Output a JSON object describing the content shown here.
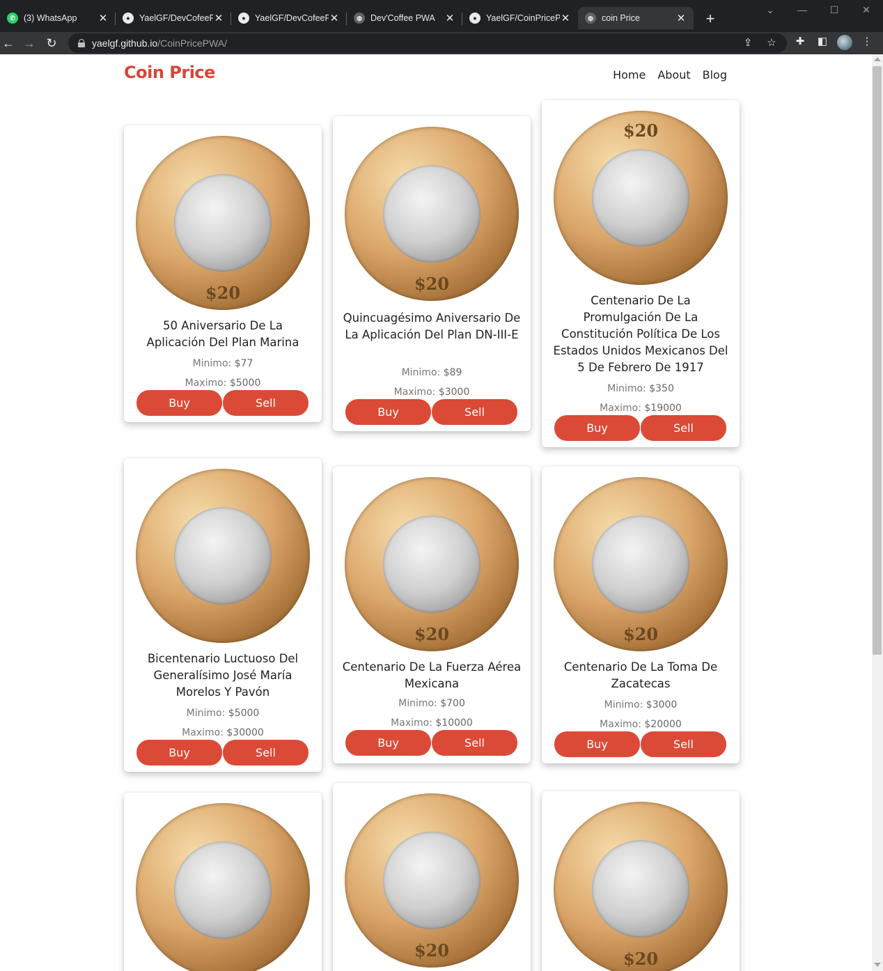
{
  "browser": {
    "tabs": [
      {
        "title": "(3) WhatsApp",
        "icon": "whatsapp-icon",
        "active": false
      },
      {
        "title": "YaelGF/DevCofeePWA",
        "icon": "github-icon",
        "active": false
      },
      {
        "title": "YaelGF/DevCofeePWA",
        "icon": "github-icon",
        "active": false
      },
      {
        "title": "Dev'Coffee PWA",
        "icon": "globe-icon",
        "active": false
      },
      {
        "title": "YaelGF/CoinPricePWA",
        "icon": "github-icon",
        "active": false
      },
      {
        "title": "coin Price",
        "icon": "globe-icon",
        "active": true
      }
    ],
    "url_host": "yaelgf.github.io",
    "url_path": "/CoinPricePWA/"
  },
  "header": {
    "brand": "Coin Price",
    "nav": [
      "Home",
      "About",
      "Blog"
    ]
  },
  "labels": {
    "min_label": "Minimo: ",
    "max_label": "Maximo: ",
    "buy": "Buy",
    "sell": "Sell"
  },
  "coins": [
    {
      "title": "50 Aniversario De La Aplicación Del Plan Marina",
      "min": "$77",
      "max": "$5000",
      "denomination": "$20"
    },
    {
      "title": "Quincuagésimo Aniversario De La Aplicación Del Plan DN-III-E",
      "min": "$89",
      "max": "$3000",
      "denomination": "$20"
    },
    {
      "title": "Centenario De La Promulgación De La Constitución Política De Los Estados Unidos Mexicanos Del 5 De Febrero De 1917",
      "min": "$350",
      "max": "$19000",
      "denomination": "$20"
    },
    {
      "title": "Bicentenario Luctuoso Del Generalísimo José María Morelos Y Pavón",
      "min": "$5000",
      "max": "$30000",
      "denomination": ""
    },
    {
      "title": "Centenario De La Fuerza Aérea Mexicana",
      "min": "$700",
      "max": "$10000",
      "denomination": "$20"
    },
    {
      "title": "Centenario De La Toma De Zacatecas",
      "min": "$3000",
      "max": "$20000",
      "denomination": "$20"
    },
    {
      "title": "",
      "min": "",
      "max": "",
      "denomination": ""
    },
    {
      "title": "",
      "min": "",
      "max": "",
      "denomination": "$20"
    },
    {
      "title": "",
      "min": "",
      "max": "",
      "denomination": "$20"
    }
  ]
}
